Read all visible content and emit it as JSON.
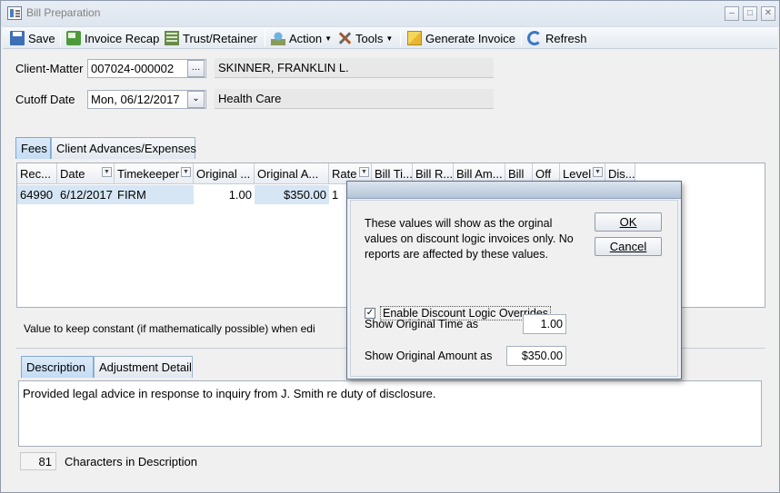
{
  "window": {
    "title": "Bill Preparation"
  },
  "toolbar": {
    "save": "Save",
    "invoice_recap": "Invoice Recap",
    "trust_retainer": "Trust/Retainer",
    "action": "Action",
    "tools": "Tools",
    "generate_invoice": "Generate Invoice",
    "refresh": "Refresh"
  },
  "header": {
    "client_matter_label": "Client-Matter",
    "client_matter_value": "007024-000002",
    "client_name": "SKINNER, FRANKLIN L.",
    "cutoff_label": "Cutoff Date",
    "cutoff_value": "Mon, 06/12/2017",
    "matter_description": "Health Care"
  },
  "tabs": {
    "fees": "Fees",
    "client_advances": "Client Advances/Expenses"
  },
  "grid": {
    "columns": [
      "Rec...",
      "Date",
      "Timekeeper",
      "Original ...",
      "Original A...",
      "Rate",
      "Bill Ti...",
      "Bill R...",
      "Bill Am...",
      "Bill",
      "Off",
      "Level",
      "Dis..."
    ],
    "row": [
      "64990",
      "6/12/2017",
      "FIRM",
      "1.00",
      "$350.00",
      "1"
    ]
  },
  "constant_text": "Value to keep constant (if mathematically possible)  when edi",
  "lower_tabs": {
    "description": "Description",
    "adjustment_detail": "Adjustment Detail"
  },
  "description": {
    "text": "Provided legal advice in response to inquiry from J. Smith re duty of disclosure.",
    "char_count": "81",
    "char_count_label": "Characters in Description"
  },
  "dialog": {
    "message": "These values will show as the orginal values on discount logic invoices only. No reports are affected by these values.",
    "ok": "OK",
    "cancel": "Cancel",
    "enable_label": "Enable Discount Logic Overrides",
    "enable_checked": true,
    "orig_time_label": "Show Original Time as",
    "orig_time_value": "1.00",
    "orig_amount_label": "Show Original Amount as",
    "orig_amount_value": "$350.00"
  }
}
